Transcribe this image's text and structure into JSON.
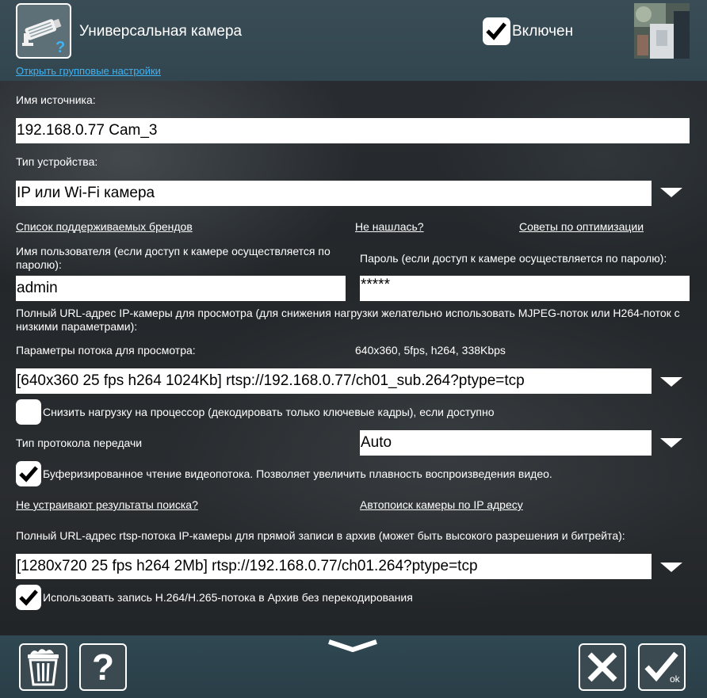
{
  "header": {
    "title": "Универсальная камера",
    "group_settings_link": "Открыть групповые настройки",
    "enabled_label": "Включен",
    "enabled_checked": true
  },
  "source": {
    "name_label": "Имя источника:",
    "name_value": "192.168.0.77 Cam_3",
    "device_type_label": "Тип устройства:",
    "device_type_value": "IP или Wi-Fi камера"
  },
  "links_row1": {
    "brands": "Список поддерживаемых брендов",
    "not_found": "Не нашлась?",
    "tips": "Советы по оптимизации"
  },
  "auth": {
    "user_label": "Имя пользователя (если доступ к камере осуществляется по паролю):",
    "user_value": "admin",
    "password_label": "Пароль (если доступ к камере осуществляется по паролю):",
    "password_value": "*****"
  },
  "view_stream": {
    "url_label": "Полный URL-адрес IP-камеры для просмотра (для снижения нагрузки желательно использовать MJPEG-поток или H264-поток с низкими параметрами):",
    "params_label": "Параметры потока для просмотра:",
    "params_value": "640x360, 5fps, h264, 338Kbps",
    "stream_value": "[640x360 25 fps h264 1024Kb] rtsp://192.168.0.77/ch01_sub.264?ptype=tcp",
    "reduce_cpu_label": "Снизить нагрузку на процессор (декодировать только ключевые кадры), если доступно",
    "reduce_cpu_checked": false
  },
  "protocol": {
    "label": "Тип протокола передачи",
    "value": "Auto"
  },
  "buffered": {
    "label": "Буферизированное чтение видеопотока. Позволяет увеличить плавность воспроизведения видео.",
    "checked": true
  },
  "links_row2": {
    "search_results": "Не устраивают результаты поиска?",
    "autosearch": "Автопоиск камеры по IP адресу"
  },
  "record_stream": {
    "label": "Полный URL-адрес rtsp-потока IP-камеры для прямой записи в архив (может быть высокого разрешения и битрейта):",
    "value": "[1280x720 25 fps h264 2Mb] rtsp://192.168.0.77/ch01.264?ptype=tcp",
    "no_transcode_label": "Использовать запись H.264/H.265-потока в Архив без перекодирования",
    "no_transcode_checked": true
  },
  "footer": {
    "ok_label": "ok",
    "help_label": "?"
  },
  "colors": {
    "link_blue": "#3fb3f3",
    "band": "#324650"
  }
}
